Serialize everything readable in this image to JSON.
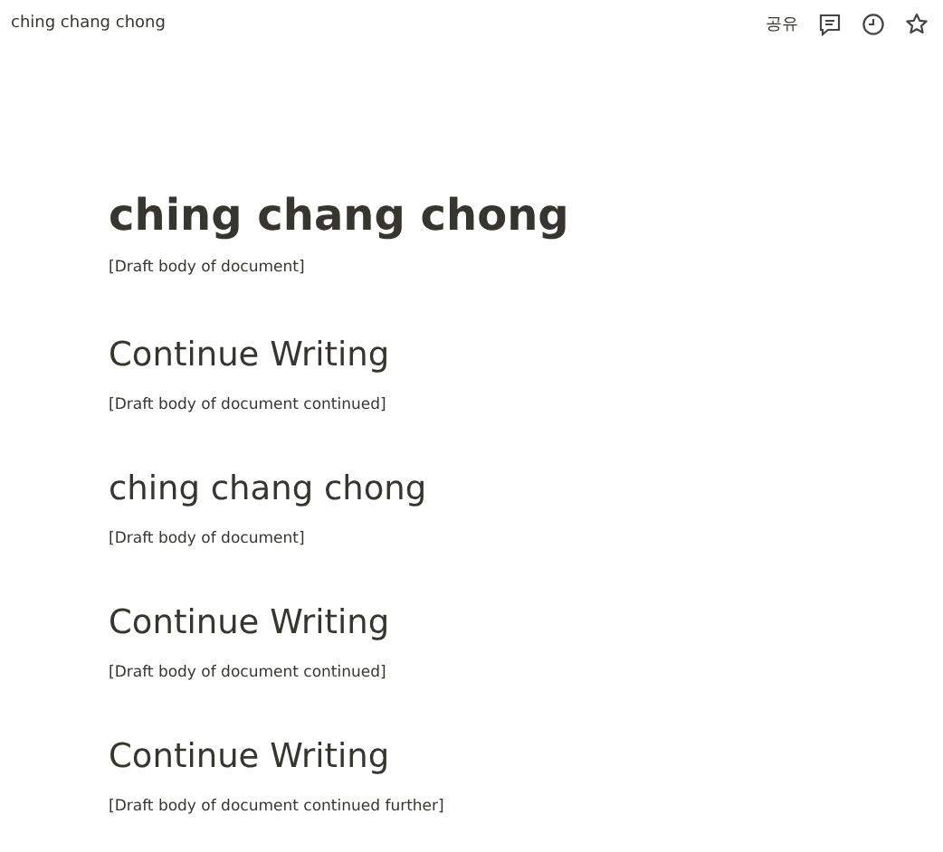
{
  "topbar": {
    "page_title": "ching chang chong",
    "share_label": "공유"
  },
  "blocks": [
    {
      "kind": "title",
      "heading": "ching chang chong",
      "body": "[Draft body of document]"
    },
    {
      "kind": "heading",
      "heading": "Continue Writing",
      "body": "[Draft body of document continued]"
    },
    {
      "kind": "heading",
      "heading": "ching chang chong",
      "body": "[Draft body of document]"
    },
    {
      "kind": "heading",
      "heading": "Continue Writing",
      "body": "[Draft body of document continued]"
    },
    {
      "kind": "heading",
      "heading": "Continue Writing",
      "body": "[Draft body of document continued further]"
    }
  ]
}
